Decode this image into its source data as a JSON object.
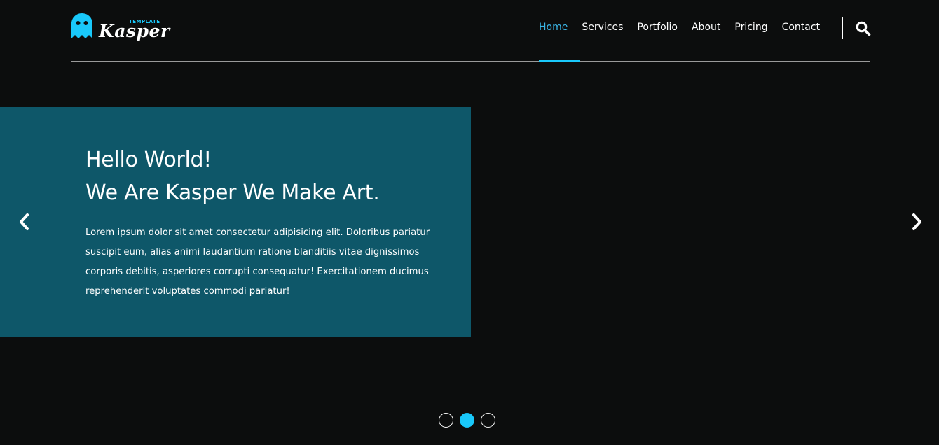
{
  "logo": {
    "small_text": "TEMPLATE",
    "main_text": "Kasper",
    "accent_color": "#19c8fa",
    "icon": "ghost-icon"
  },
  "nav": {
    "items": [
      {
        "label": "Home",
        "active": true
      },
      {
        "label": "Services",
        "active": false
      },
      {
        "label": "Portfolio",
        "active": false
      },
      {
        "label": "About",
        "active": false
      },
      {
        "label": "Pricing",
        "active": false
      },
      {
        "label": "Contact",
        "active": false
      }
    ],
    "search_icon": "search-icon"
  },
  "slide": {
    "title_line1": "Hello World!",
    "title_line2": "We Are Kasper We Make Art.",
    "body": "Lorem ipsum dolor sit amet consectetur adipisicing elit. Doloribus pariatur suscipit eum, alias animi laudantium ratione blanditiis vitae dignissimos corporis debitis, asperiores corrupti consequatur! Exercitationem ducimus reprehenderit voluptates commodi pariatur!",
    "panel_color": "#0e5769"
  },
  "slider": {
    "prev_icon": "chevron-left-icon",
    "next_icon": "chevron-right-icon",
    "bullets": [
      {
        "active": false
      },
      {
        "active": true
      },
      {
        "active": false
      }
    ]
  },
  "colors": {
    "background": "#0c0d0d",
    "accent": "#19c8fa",
    "nav_active": "#3ab7e8"
  }
}
